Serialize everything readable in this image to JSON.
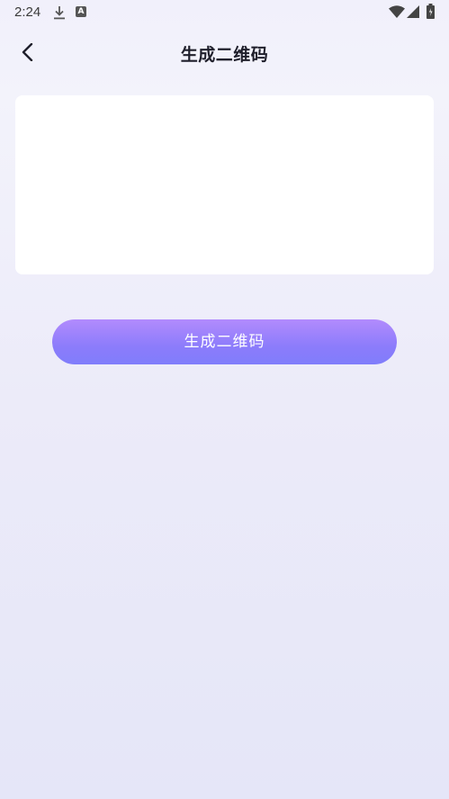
{
  "status_bar": {
    "time": "2:24",
    "icons": [
      "download-icon",
      "a-icon",
      "wifi-icon",
      "signal-icon",
      "battery-icon"
    ],
    "a_icon_letter": "A"
  },
  "header": {
    "back_icon": "chevron-left-icon",
    "title": "生成二维码"
  },
  "input": {
    "value": "",
    "placeholder": ""
  },
  "generate_button": {
    "label": "生成二维码"
  },
  "colors": {
    "accent_gradient_top": "#b28bfd",
    "accent_gradient_bottom": "#807dfb",
    "background": "#eeedf9",
    "card": "#ffffff",
    "title_text": "#1f1f2b"
  }
}
